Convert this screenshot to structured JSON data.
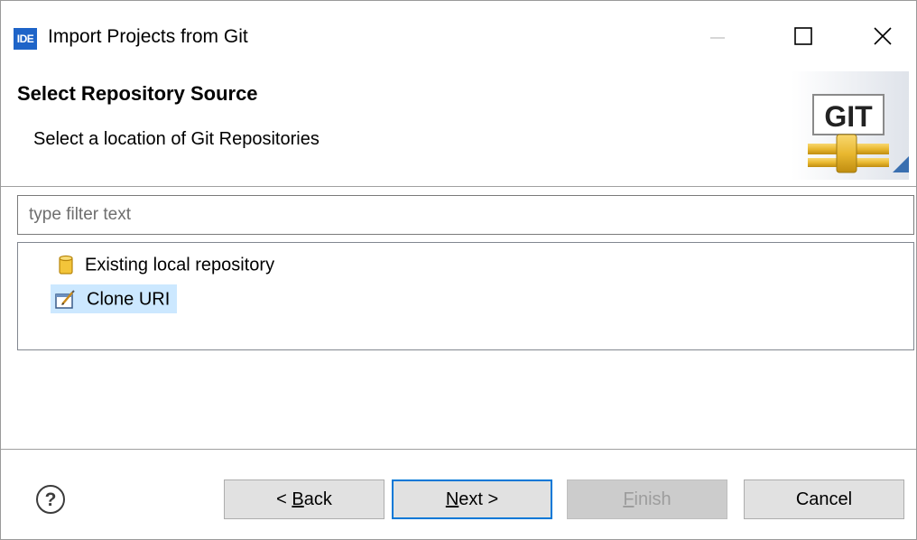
{
  "window": {
    "icon_text": "IDE",
    "title": "Import Projects from Git"
  },
  "header": {
    "title": "Select Repository Source",
    "description": "Select a location of Git Repositories",
    "banner_text": "GIT"
  },
  "filter": {
    "placeholder": "type filter text",
    "value": ""
  },
  "tree": {
    "items": [
      {
        "label": "Existing local repository",
        "icon": "repository-cylinder-icon",
        "selected": false
      },
      {
        "label": "Clone URI",
        "icon": "clone-uri-icon",
        "selected": true
      }
    ]
  },
  "footer": {
    "back": {
      "prefix": "< ",
      "mnemonic": "B",
      "rest": "ack"
    },
    "next": {
      "mnemonic": "N",
      "rest": "ext >"
    },
    "finish": {
      "mnemonic": "F",
      "rest": "inish"
    },
    "cancel": "Cancel"
  },
  "colors": {
    "selection": "#cce8ff",
    "default_button_border": "#0078d7",
    "app_icon": "#1e64c8"
  }
}
